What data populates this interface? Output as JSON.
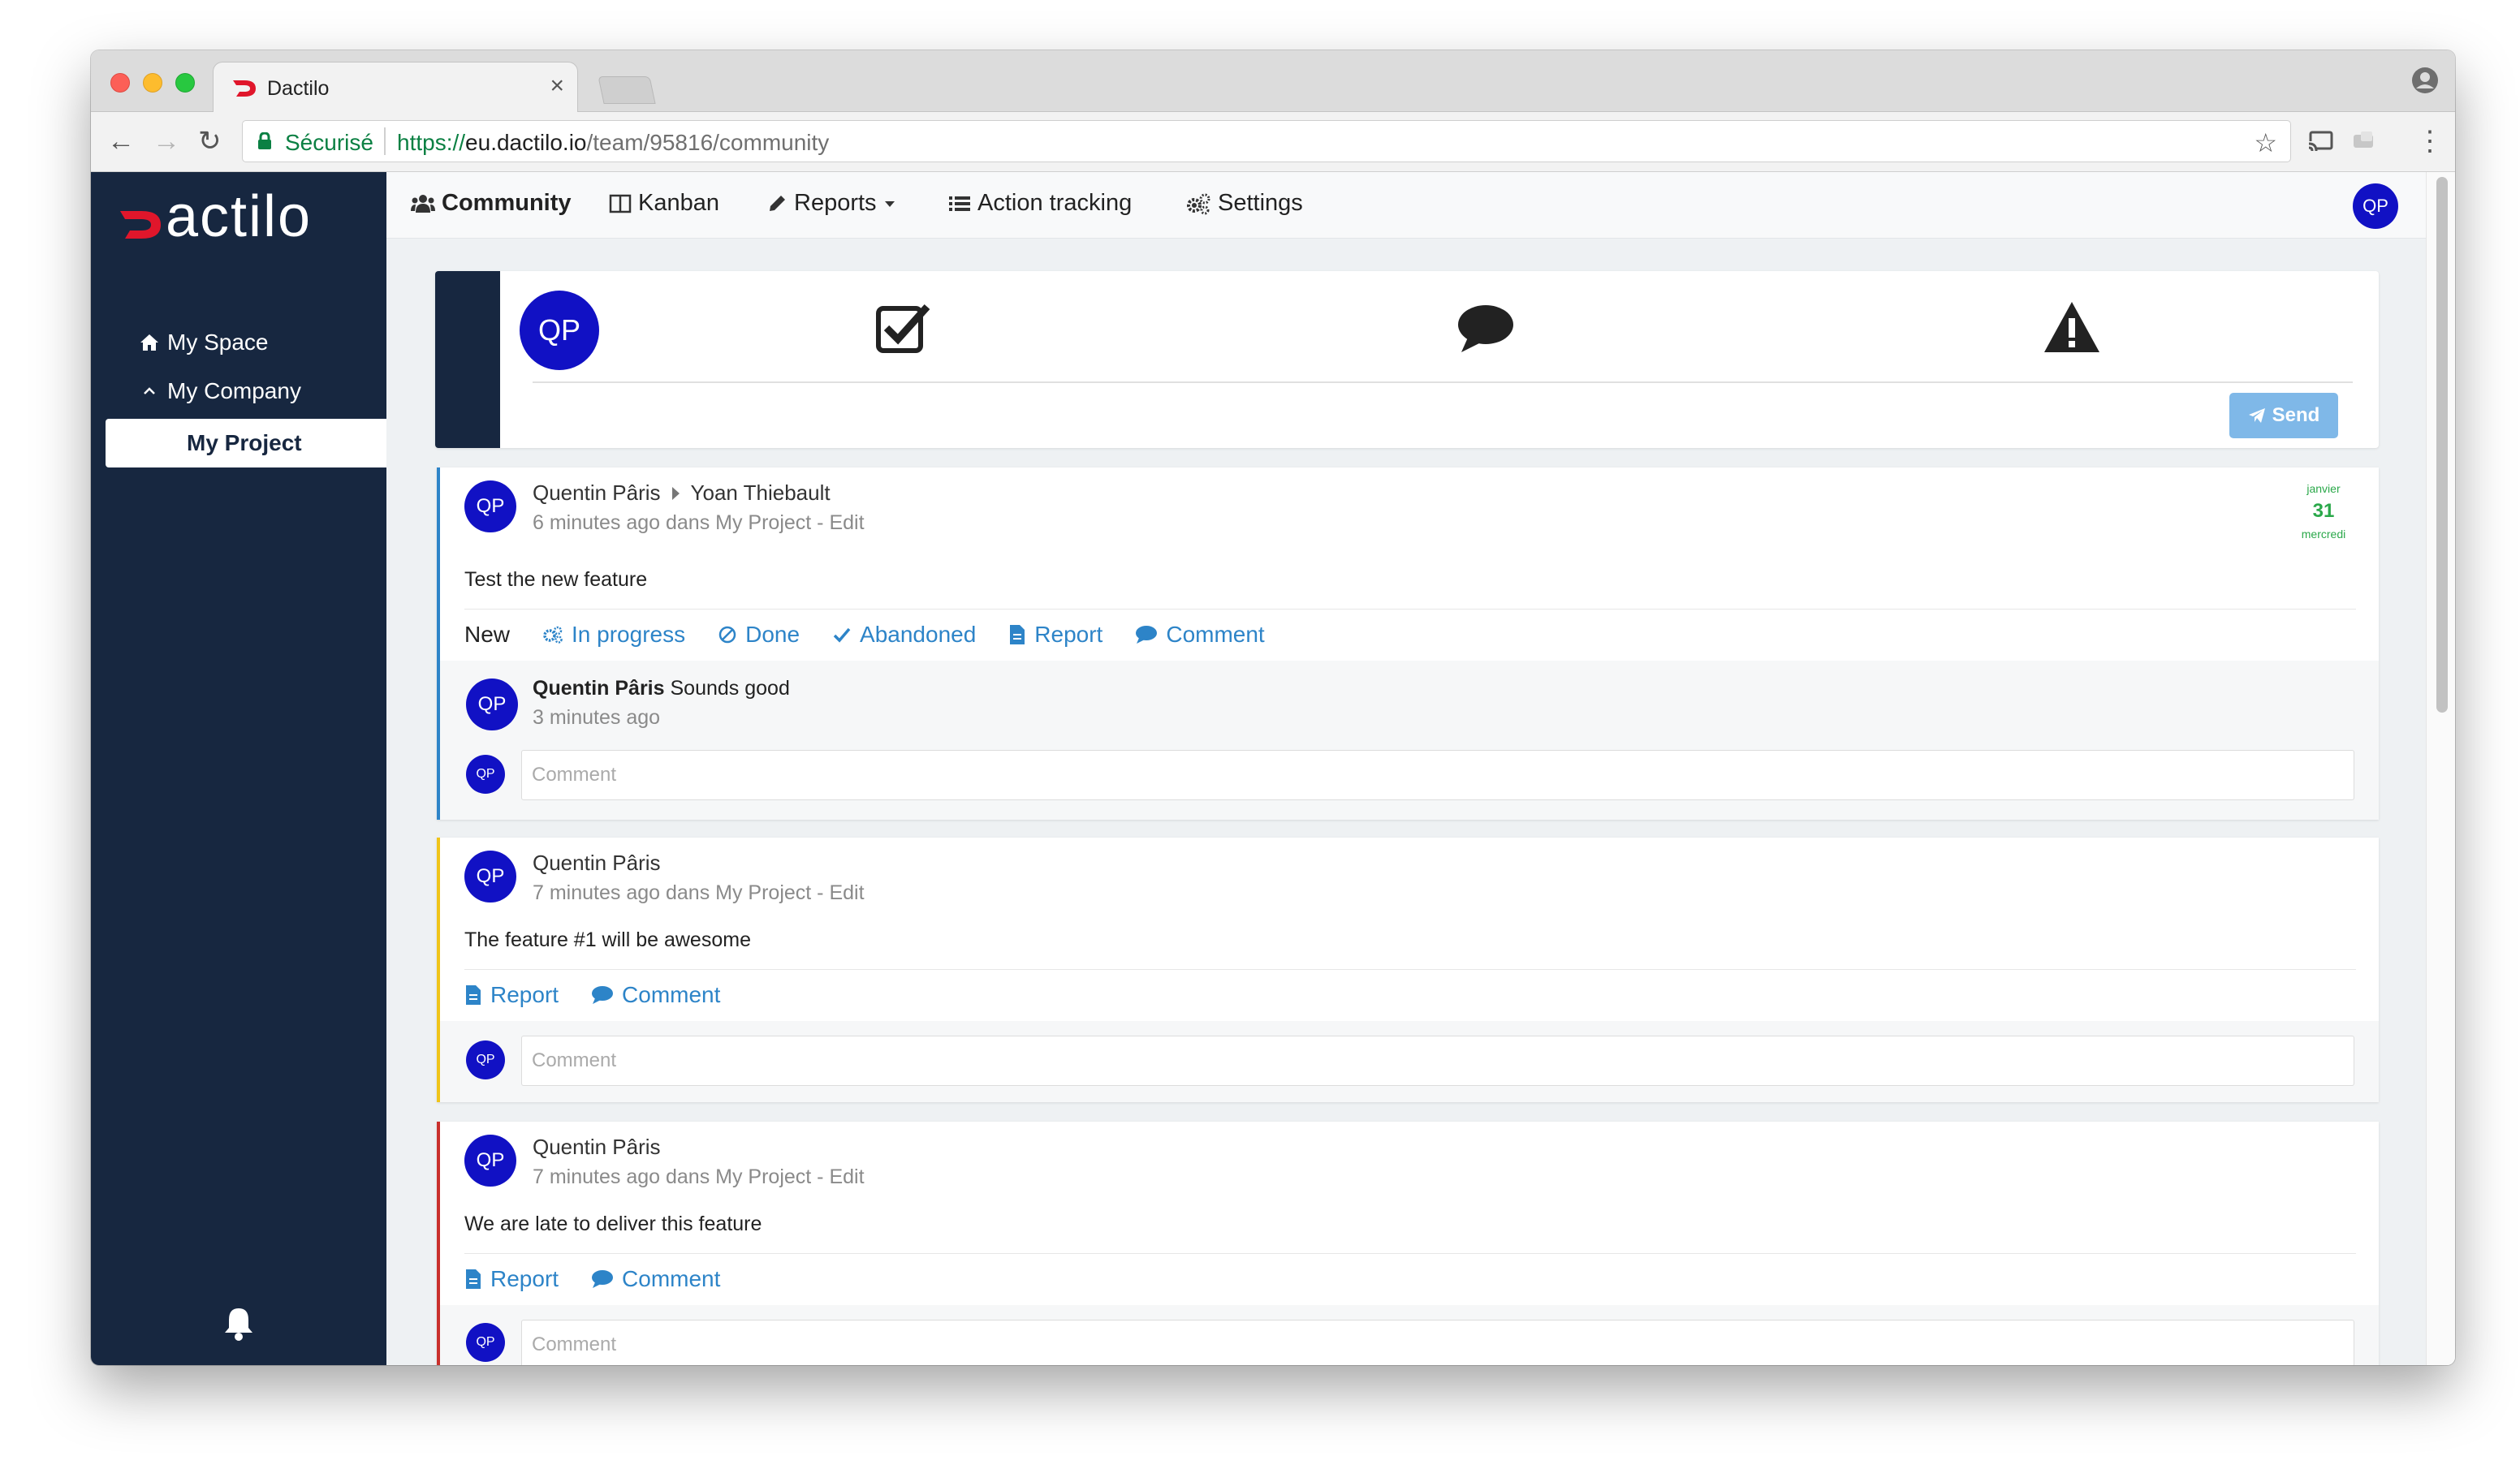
{
  "browser": {
    "tab_title": "Dactilo",
    "secure_label": "Sécurisé",
    "url_scheme": "https://",
    "url_host": "eu.dactilo.io",
    "url_path": "/team/95816/community"
  },
  "sidebar": {
    "brand": "actilo",
    "items": [
      {
        "label": "My Space",
        "icon": "home-icon"
      },
      {
        "label": "My Company",
        "icon": "chevron-up-icon"
      },
      {
        "label": "My Project",
        "icon": ""
      }
    ]
  },
  "topnav": {
    "items": [
      {
        "label": "Community",
        "icon": "users-icon"
      },
      {
        "label": "Kanban",
        "icon": "columns-icon"
      },
      {
        "label": "Reports",
        "icon": "pencil-icon"
      },
      {
        "label": "Action tracking",
        "icon": "list-icon"
      },
      {
        "label": "Settings",
        "icon": "cogs-icon"
      }
    ],
    "avatar": "QP"
  },
  "composer": {
    "avatar": "QP",
    "send_label": "Send"
  },
  "posts": [
    {
      "avatar": "QP",
      "author": "Quentin Pâris",
      "recipient": "Yoan Thiebault",
      "meta": "6 minutes ago dans My Project - Edit",
      "content": "Test the new feature",
      "accent": "#2d84c8",
      "actions": [
        "New",
        "In progress",
        "Done",
        "Abandoned",
        "Report",
        "Comment"
      ],
      "date": {
        "month": "janvier",
        "day": "31",
        "weekday": "mercredi"
      },
      "comment": {
        "avatar": "QP",
        "author": "Quentin Pâris",
        "text": "Sounds good",
        "time": "3 minutes ago"
      },
      "comment_placeholder": "Comment",
      "comment_avatar": "QP"
    },
    {
      "avatar": "QP",
      "author": "Quentin Pâris",
      "meta": "7 minutes ago dans My Project - Edit",
      "content": "The feature #1 will be awesome",
      "accent": "#f0c419",
      "actions": [
        "Report",
        "Comment"
      ],
      "comment_placeholder": "Comment",
      "comment_avatar": "QP"
    },
    {
      "avatar": "QP",
      "author": "Quentin Pâris",
      "meta": "7 minutes ago dans My Project - Edit",
      "content": "We are late to deliver this feature",
      "accent": "#c9302c",
      "actions": [
        "Report",
        "Comment"
      ],
      "comment_placeholder": "Comment",
      "comment_avatar": "QP"
    }
  ],
  "colors": {
    "sidebar": "#172740",
    "avatar": "#1111c4",
    "link": "#2d84c8",
    "send": "#7fb8e8"
  }
}
